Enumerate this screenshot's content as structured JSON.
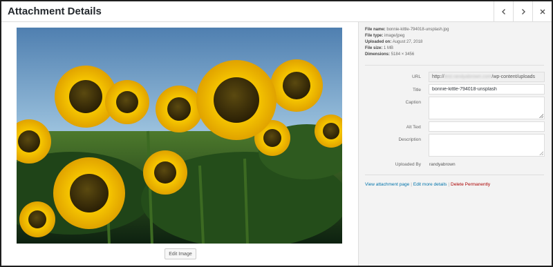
{
  "header": {
    "title": "Attachment Details"
  },
  "nav": {
    "prev_icon": "chevron-left",
    "next_icon": "chevron-right",
    "close_icon": "close"
  },
  "image": {
    "alt": "sunflowers photo"
  },
  "edit_image_label": "Edit Image",
  "file_info": {
    "file_name_label": "File name:",
    "file_name": "bonnie-kittle-794018-unsplash.jpg",
    "file_type_label": "File type:",
    "file_type": "image/jpeg",
    "uploaded_on_label": "Uploaded on:",
    "uploaded_on": "August 27, 2018",
    "file_size_label": "File size:",
    "file_size": "1 MB",
    "dimensions_label": "Dimensions:",
    "dimensions": "5184 × 3456"
  },
  "fields": {
    "url_label": "URL",
    "url_prefix": "http://",
    "url_blurred": "test.randyabrown.com",
    "url_suffix": "/wp-content/uploads",
    "title_label": "Title",
    "title_value": "bonnie-kittle-794018-unsplash",
    "caption_label": "Caption",
    "caption_value": "",
    "alt_label": "Alt Text",
    "alt_value": "",
    "description_label": "Description",
    "description_value": "",
    "uploaded_by_label": "Uploaded By",
    "uploaded_by_value": "randyabrown"
  },
  "actions": {
    "view_page": "View attachment page",
    "edit_details": "Edit more details",
    "delete": "Delete Permanently",
    "separator": "|"
  }
}
